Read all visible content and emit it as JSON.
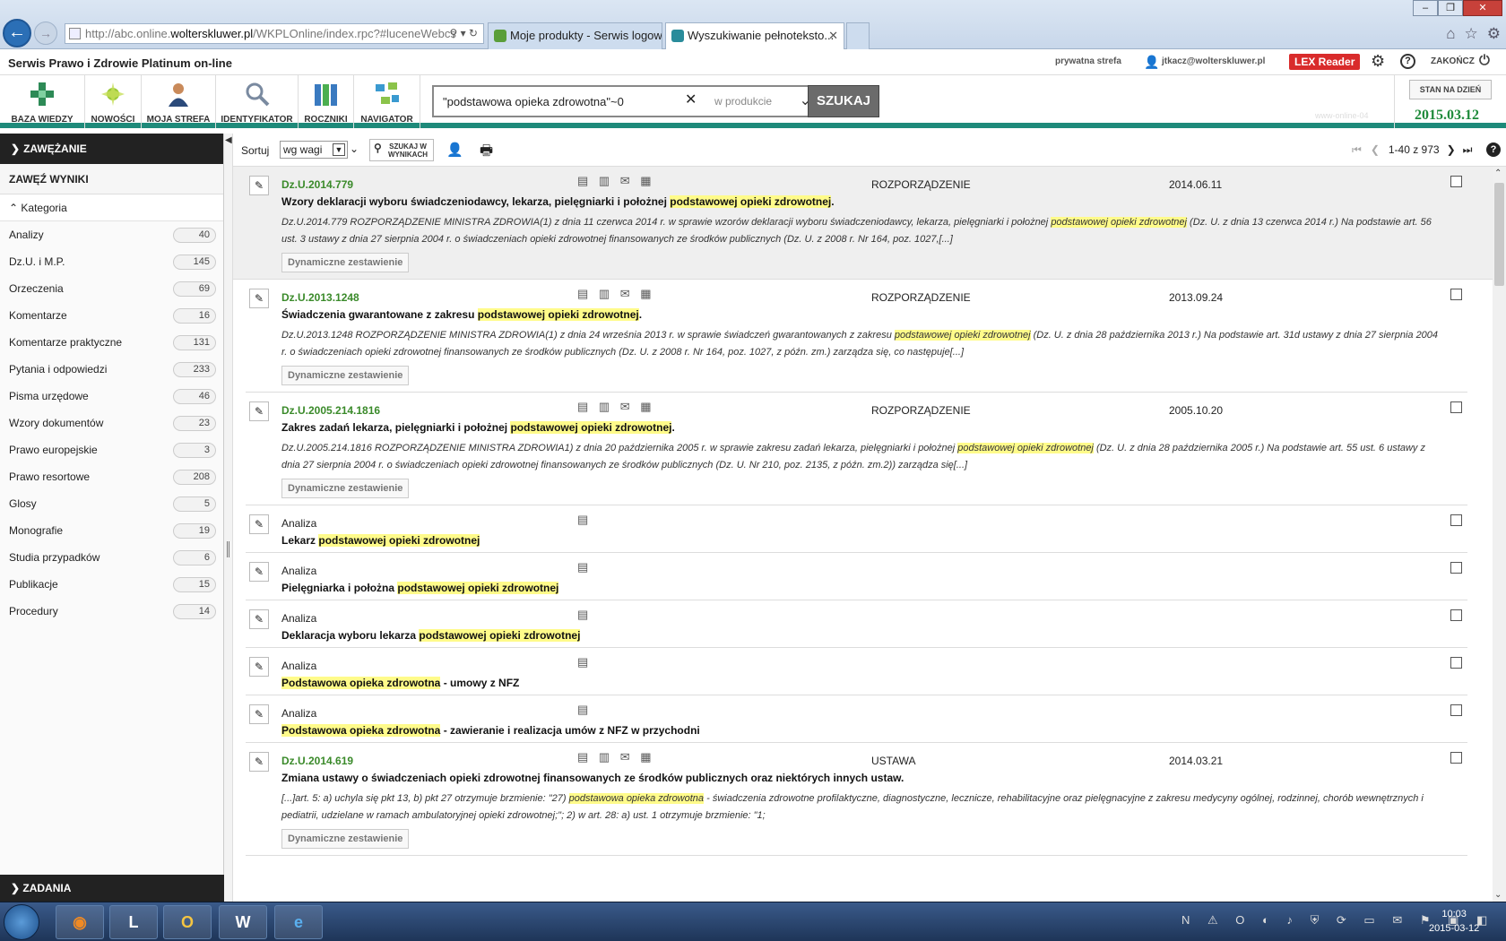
{
  "browser": {
    "address_url_prefix": "http://abc.online.",
    "address_url_domain": "wolterskluwer.pl",
    "address_url_suffix": "/WKPLOnline/index.rpc?#luceneWebcs",
    "tabs": [
      {
        "label": "Moje produkty - Serwis logow..."
      },
      {
        "label": "Wyszukiwanie pełnotekstо..."
      }
    ]
  },
  "header": {
    "app_title": "Serwis Prawo i Zdrowie Platinum on-line",
    "private_zone": "prywatna strefa",
    "user_email": "jtkacz@wolterskluwer.pl",
    "lex_reader": "LEX Reader",
    "end_label": "ZAKOŃCZ"
  },
  "toolbar": {
    "items": [
      {
        "label": "BAZA WIEDZY",
        "icon": "knowledge-base-icon"
      },
      {
        "label": "NOWOŚCI",
        "icon": "news-icon"
      },
      {
        "label": "MOJA STREFA",
        "icon": "my-zone-icon"
      },
      {
        "label": "IDENTYFIKATOR",
        "icon": "identifier-icon"
      },
      {
        "label": "ROCZNIKI",
        "icon": "yearbooks-icon"
      },
      {
        "label": "NAVIGATOR",
        "icon": "navigator-icon"
      }
    ],
    "search_value": "\"podstawowa opieka zdrowotna\"~0",
    "search_scope": "w produkcie",
    "search_button": "SZUKAJ",
    "state_button": "STAN NA DZIEŃ",
    "state_date": "2015.03.12",
    "ghost_text": "www-online-04"
  },
  "sidebar": {
    "narrow_header": "ZAWĘŻANIE",
    "narrow_title": "ZAWĘŹ WYNIKI",
    "category_header": "Kategoria",
    "categories": [
      {
        "label": "Analizy",
        "count": "40"
      },
      {
        "label": "Dz.U. i M.P.",
        "count": "145"
      },
      {
        "label": "Orzeczenia",
        "count": "69"
      },
      {
        "label": "Komentarze",
        "count": "16"
      },
      {
        "label": "Komentarze praktyczne",
        "count": "131"
      },
      {
        "label": "Pytania i odpowiedzi",
        "count": "233"
      },
      {
        "label": "Pisma urzędowe",
        "count": "46"
      },
      {
        "label": "Wzory dokumentów",
        "count": "23"
      },
      {
        "label": "Prawo europejskie",
        "count": "3"
      },
      {
        "label": "Prawo resortowe",
        "count": "208"
      },
      {
        "label": "Glosy",
        "count": "5"
      },
      {
        "label": "Monografie",
        "count": "19"
      },
      {
        "label": "Studia przypadków",
        "count": "6"
      },
      {
        "label": "Publikacje",
        "count": "15"
      },
      {
        "label": "Procedury",
        "count": "14"
      }
    ],
    "tasks": "ZADANIA"
  },
  "results_bar": {
    "sort_label": "Sortuj",
    "sort_value": "wg wagi",
    "search_in_results": "SZUKAJ W WYNIKACH",
    "pager": "1-40 z 973"
  },
  "results": [
    {
      "ref": "Dz.U.2014.779",
      "type": "ROZPORZĄDZENIE",
      "date": "2014.06.11",
      "title_pre": "Wzory deklaracji wyboru świadczeniodawcy, lekarza, pielęgniarki i położnej ",
      "title_hl": "podstawowej opieki zdrowotnej",
      "title_post": ".",
      "snip_pre": "Dz.U.2014.779 ROZPORZĄDZENIE MINISTRA ZDROWIA(1) z dnia 11 czerwca 2014 r. w sprawie wzorów deklaracji wyboru świadczeniodawcy, lekarza, pielęgniarki i położnej ",
      "snip_hl": "podstawowej opieki zdrowotnej",
      "snip_post": " (Dz. U. z dnia 13 czerwca 2014 r.) Na podstawie art. 56 ust. 3 ustawy z dnia 27 sierpnia 2004 r. o świadczeniach opieki zdrowotnej finansowanych ze środków publicznych (Dz. U. z 2008 r. Nr 164, poz. 1027,[...]",
      "dyn": "Dynamiczne zestawienie"
    },
    {
      "ref": "Dz.U.2013.1248",
      "type": "ROZPORZĄDZENIE",
      "date": "2013.09.24",
      "title_pre": "Świadczenia gwarantowane z zakresu ",
      "title_hl": "podstawowej opieki zdrowotnej",
      "title_post": ".",
      "snip_pre": "Dz.U.2013.1248 ROZPORZĄDZENIE MINISTRA ZDROWIA(1) z dnia 24 września 2013 r. w sprawie świadczeń gwarantowanych z zakresu ",
      "snip_hl": "podstawowej opieki zdrowotnej",
      "snip_post": " (Dz. U. z dnia 28 października 2013 r.) Na podstawie art. 31d ustawy z dnia 27 sierpnia 2004 r. o świadczeniach opieki zdrowotnej finansowanych ze środków publicznych (Dz. U. z 2008 r. Nr 164, poz. 1027, z późn. zm.) zarządza się, co następuje[...]",
      "dyn": "Dynamiczne zestawienie"
    },
    {
      "ref": "Dz.U.2005.214.1816",
      "type": "ROZPORZĄDZENIE",
      "date": "2005.10.20",
      "title_pre": "Zakres zadań lekarza, pielęgniarki i położnej ",
      "title_hl": "podstawowej opieki zdrowotnej",
      "title_post": ".",
      "snip_pre": "Dz.U.2005.214.1816 ROZPORZĄDZENIE MINISTRA ZDROWIA1) z dnia 20 października 2005 r. w sprawie zakresu zadań lekarza, pielęgniarki i położnej ",
      "snip_hl": "podstawowej opieki zdrowotnej",
      "snip_post": " (Dz. U. z dnia 28 października 2005 r.) Na podstawie art. 55 ust. 6 ustawy z dnia 27 sierpnia 2004 r. o świadczeniach opieki zdrowotnej finansowanych ze środków publicznych (Dz. U. Nr 210, poz. 2135, z późn. zm.2)) zarządza się[...]",
      "dyn": "Dynamiczne zestawienie"
    },
    {
      "kind": "Analiza",
      "title_pre": "Lekarz ",
      "title_hl": "podstawowej opieki zdrowotnej",
      "title_post": ""
    },
    {
      "kind": "Analiza",
      "title_pre": "Pielęgniarka i położna ",
      "title_hl": "podstawowej opieki zdrowotnej",
      "title_post": ""
    },
    {
      "kind": "Analiza",
      "title_pre": "Deklaracja wyboru lekarza ",
      "title_hl": "podstawowej opieki zdrowotnej",
      "title_post": ""
    },
    {
      "kind": "Analiza",
      "title_pre": "",
      "title_hl": "Podstawowa opieka zdrowotna",
      "title_post": " - umowy z NFZ"
    },
    {
      "kind": "Analiza",
      "title_pre": "",
      "title_hl": "Podstawowa opieka zdrowotna",
      "title_post": " - zawieranie i realizacja umów z NFZ w przychodni"
    },
    {
      "ref": "Dz.U.2014.619",
      "type": "USTAWA",
      "date": "2014.03.21",
      "title_pre": "Zmiana ustawy o świadczeniach opieki zdrowotnej finansowanych ze środków publicznych oraz niektórych innych ustaw.",
      "title_hl": "",
      "title_post": "",
      "snip_pre": "[...]art. 5: a) uchyla się pkt 13, b) pkt 27 otrzymuje brzmienie: \"27) ",
      "snip_hl": "podstawowa opieka zdrowotna",
      "snip_post": " - świadczenia zdrowotne profilaktyczne, diagnostyczne, lecznicze, rehabilitacyjne oraz pielęgnacyjne z zakresu medycyny ogólnej, rodzinnej, chorób wewnętrznych i pediatrii, udzielane w ramach ambulatoryjnej opieki zdrowotnej;\"; 2) w art. 28: a) ust. 1 otrzymuje brzmienie: \"1;",
      "dyn": "Dynamiczne zestawienie"
    }
  ],
  "taskbar": {
    "time": "10:03",
    "date": "2015-03-12"
  }
}
